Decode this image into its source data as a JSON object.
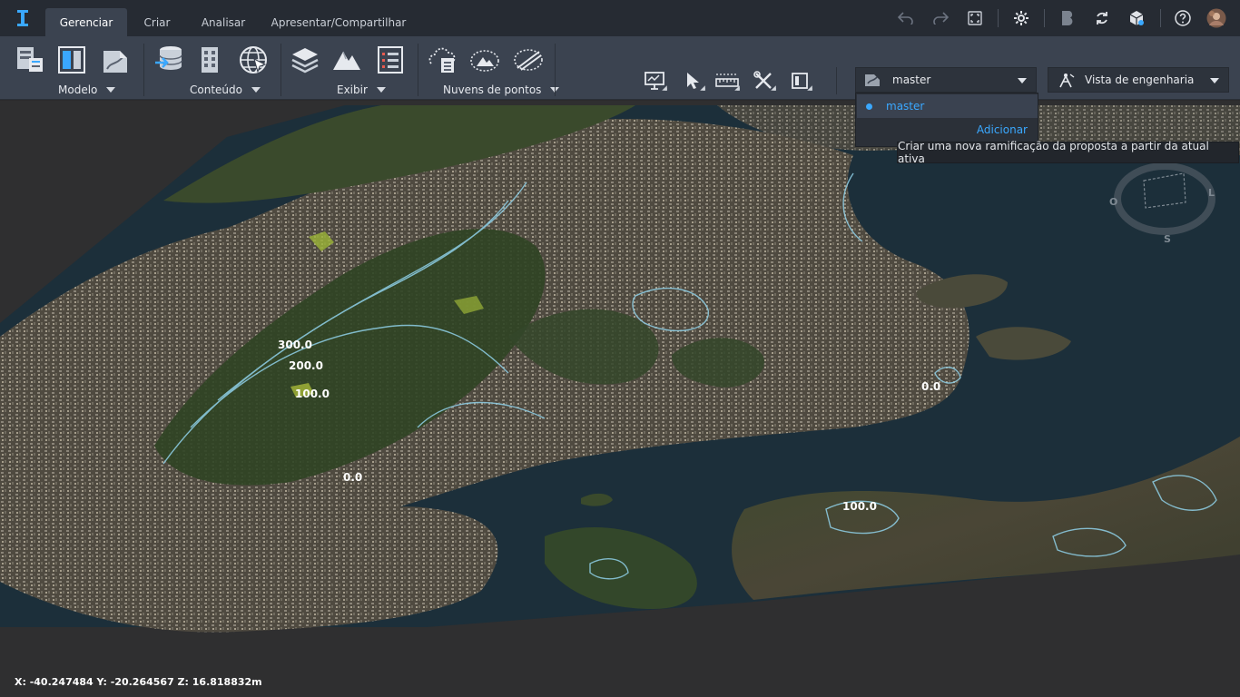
{
  "app": {
    "tabs": [
      {
        "label": "Gerenciar",
        "active": true
      },
      {
        "label": "Criar",
        "active": false
      },
      {
        "label": "Analisar",
        "active": false
      },
      {
        "label": "Apresentar/Compartilhar",
        "active": false
      }
    ],
    "header_icons": [
      "undo-icon",
      "redo-icon",
      "fit-view-icon",
      "settings-icon",
      "bim360-icon",
      "sync-icon",
      "cube-icon",
      "help-icon",
      "user-avatar"
    ]
  },
  "ribbon": {
    "groups": [
      {
        "label": "Modelo",
        "icons": [
          "model-properties-icon",
          "model-layout-icon",
          "model-map-icon"
        ]
      },
      {
        "label": "Conteúdo",
        "icons": [
          "data-sources-icon",
          "building-icon",
          "globe-icon"
        ]
      },
      {
        "label": "Exibir",
        "icons": [
          "layers-icon",
          "terrain-icon",
          "list-icon"
        ]
      },
      {
        "label": "Nuvens de pontos",
        "icons": [
          "point-cloud-icon",
          "point-cloud-terrain-icon",
          "point-cloud-slice-icon"
        ]
      }
    ],
    "tools": [
      "presentation-icon",
      "select-icon",
      "measure-icon",
      "tools-icon",
      "layout-icon"
    ],
    "branch_selector": {
      "value": "master",
      "icon": "proposal-icon"
    },
    "view_selector": {
      "value": "Vista de engenharia",
      "icon": "engineering-view-icon"
    }
  },
  "branch_menu": {
    "items": [
      "master"
    ],
    "add_label": "Adicionar",
    "tooltip": "Criar uma nova ramificação da proposta a partir da atual ativa"
  },
  "viewport": {
    "contour_labels": [
      "300.0",
      "200.0",
      "100.0",
      "0.0",
      "100.0",
      "0.0"
    ],
    "compass": {
      "west": "O",
      "east": "L",
      "south": "S"
    },
    "coordinates": "X: -40.247484 Y: -20.264567 Z: 16.818832m"
  },
  "colors": {
    "accent": "#3aa8ff",
    "topbar": "#262b33",
    "ribbon": "#3b4350",
    "water": "#1c2f3a"
  }
}
